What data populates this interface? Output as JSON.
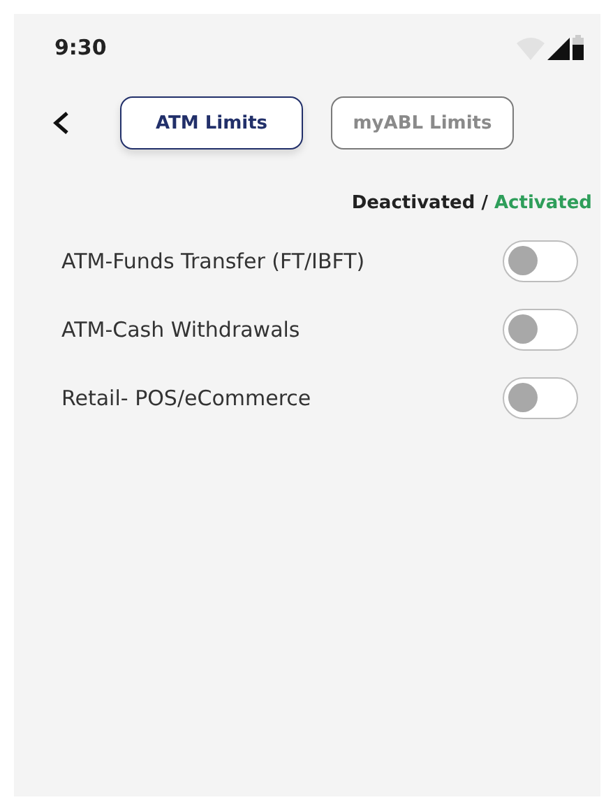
{
  "status_bar": {
    "time": "9:30"
  },
  "tabs": [
    {
      "label": "ATM Limits",
      "selected": true
    },
    {
      "label": "myABL Limits",
      "selected": false
    }
  ],
  "legend": {
    "off_label": "Deactivated",
    "separator": "/",
    "on_label": "Activated"
  },
  "limits": [
    {
      "label": "ATM-Funds Transfer (FT/IBFT)",
      "on": false
    },
    {
      "label": "ATM-Cash Withdrawals",
      "on": false
    },
    {
      "label": "Retail- POS/eCommerce",
      "on": false
    }
  ]
}
